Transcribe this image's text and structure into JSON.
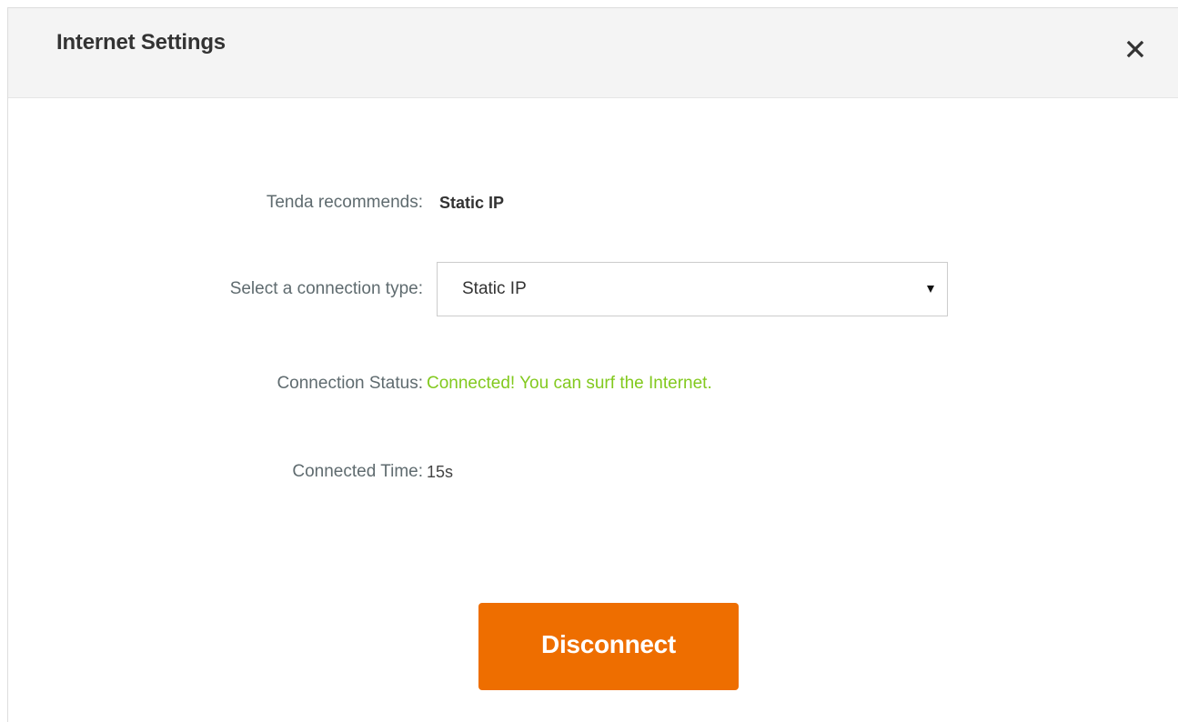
{
  "dialog": {
    "title": "Internet Settings",
    "close_icon": "close-icon"
  },
  "recommend": {
    "label": "Tenda recommends:",
    "value": "Static IP"
  },
  "connection_type": {
    "label": "Select a connection type:",
    "selected": "Static IP",
    "caret_icon": "caret-down-icon"
  },
  "status": {
    "label": "Connection Status:",
    "value": "Connected! You can surf the Internet.",
    "color": "#82c91e"
  },
  "connected_time": {
    "label": "Connected Time:",
    "value": "15s"
  },
  "actions": {
    "disconnect_label": "Disconnect",
    "accent_color": "#ee6e00"
  }
}
